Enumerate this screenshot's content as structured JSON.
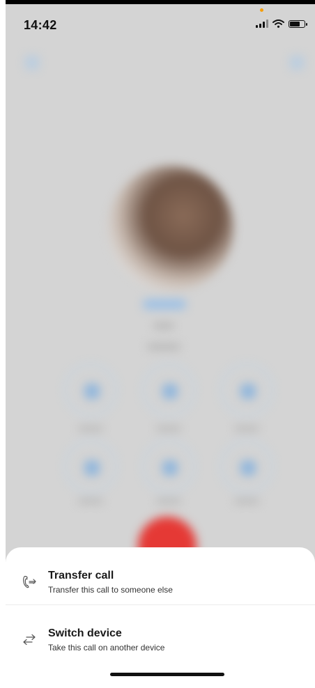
{
  "status_bar": {
    "time": "14:42"
  },
  "action_sheet": {
    "items": [
      {
        "title": "Transfer call",
        "subtitle": "Transfer this call to someone else",
        "icon": "transfer-call-icon"
      },
      {
        "title": "Switch device",
        "subtitle": "Take this call on another device",
        "icon": "switch-device-icon"
      }
    ]
  },
  "colors": {
    "hangup": "#e53935",
    "accent": "#90b6dc",
    "sheet_bg": "#ffffff",
    "overlay": "#d4d4d4"
  }
}
